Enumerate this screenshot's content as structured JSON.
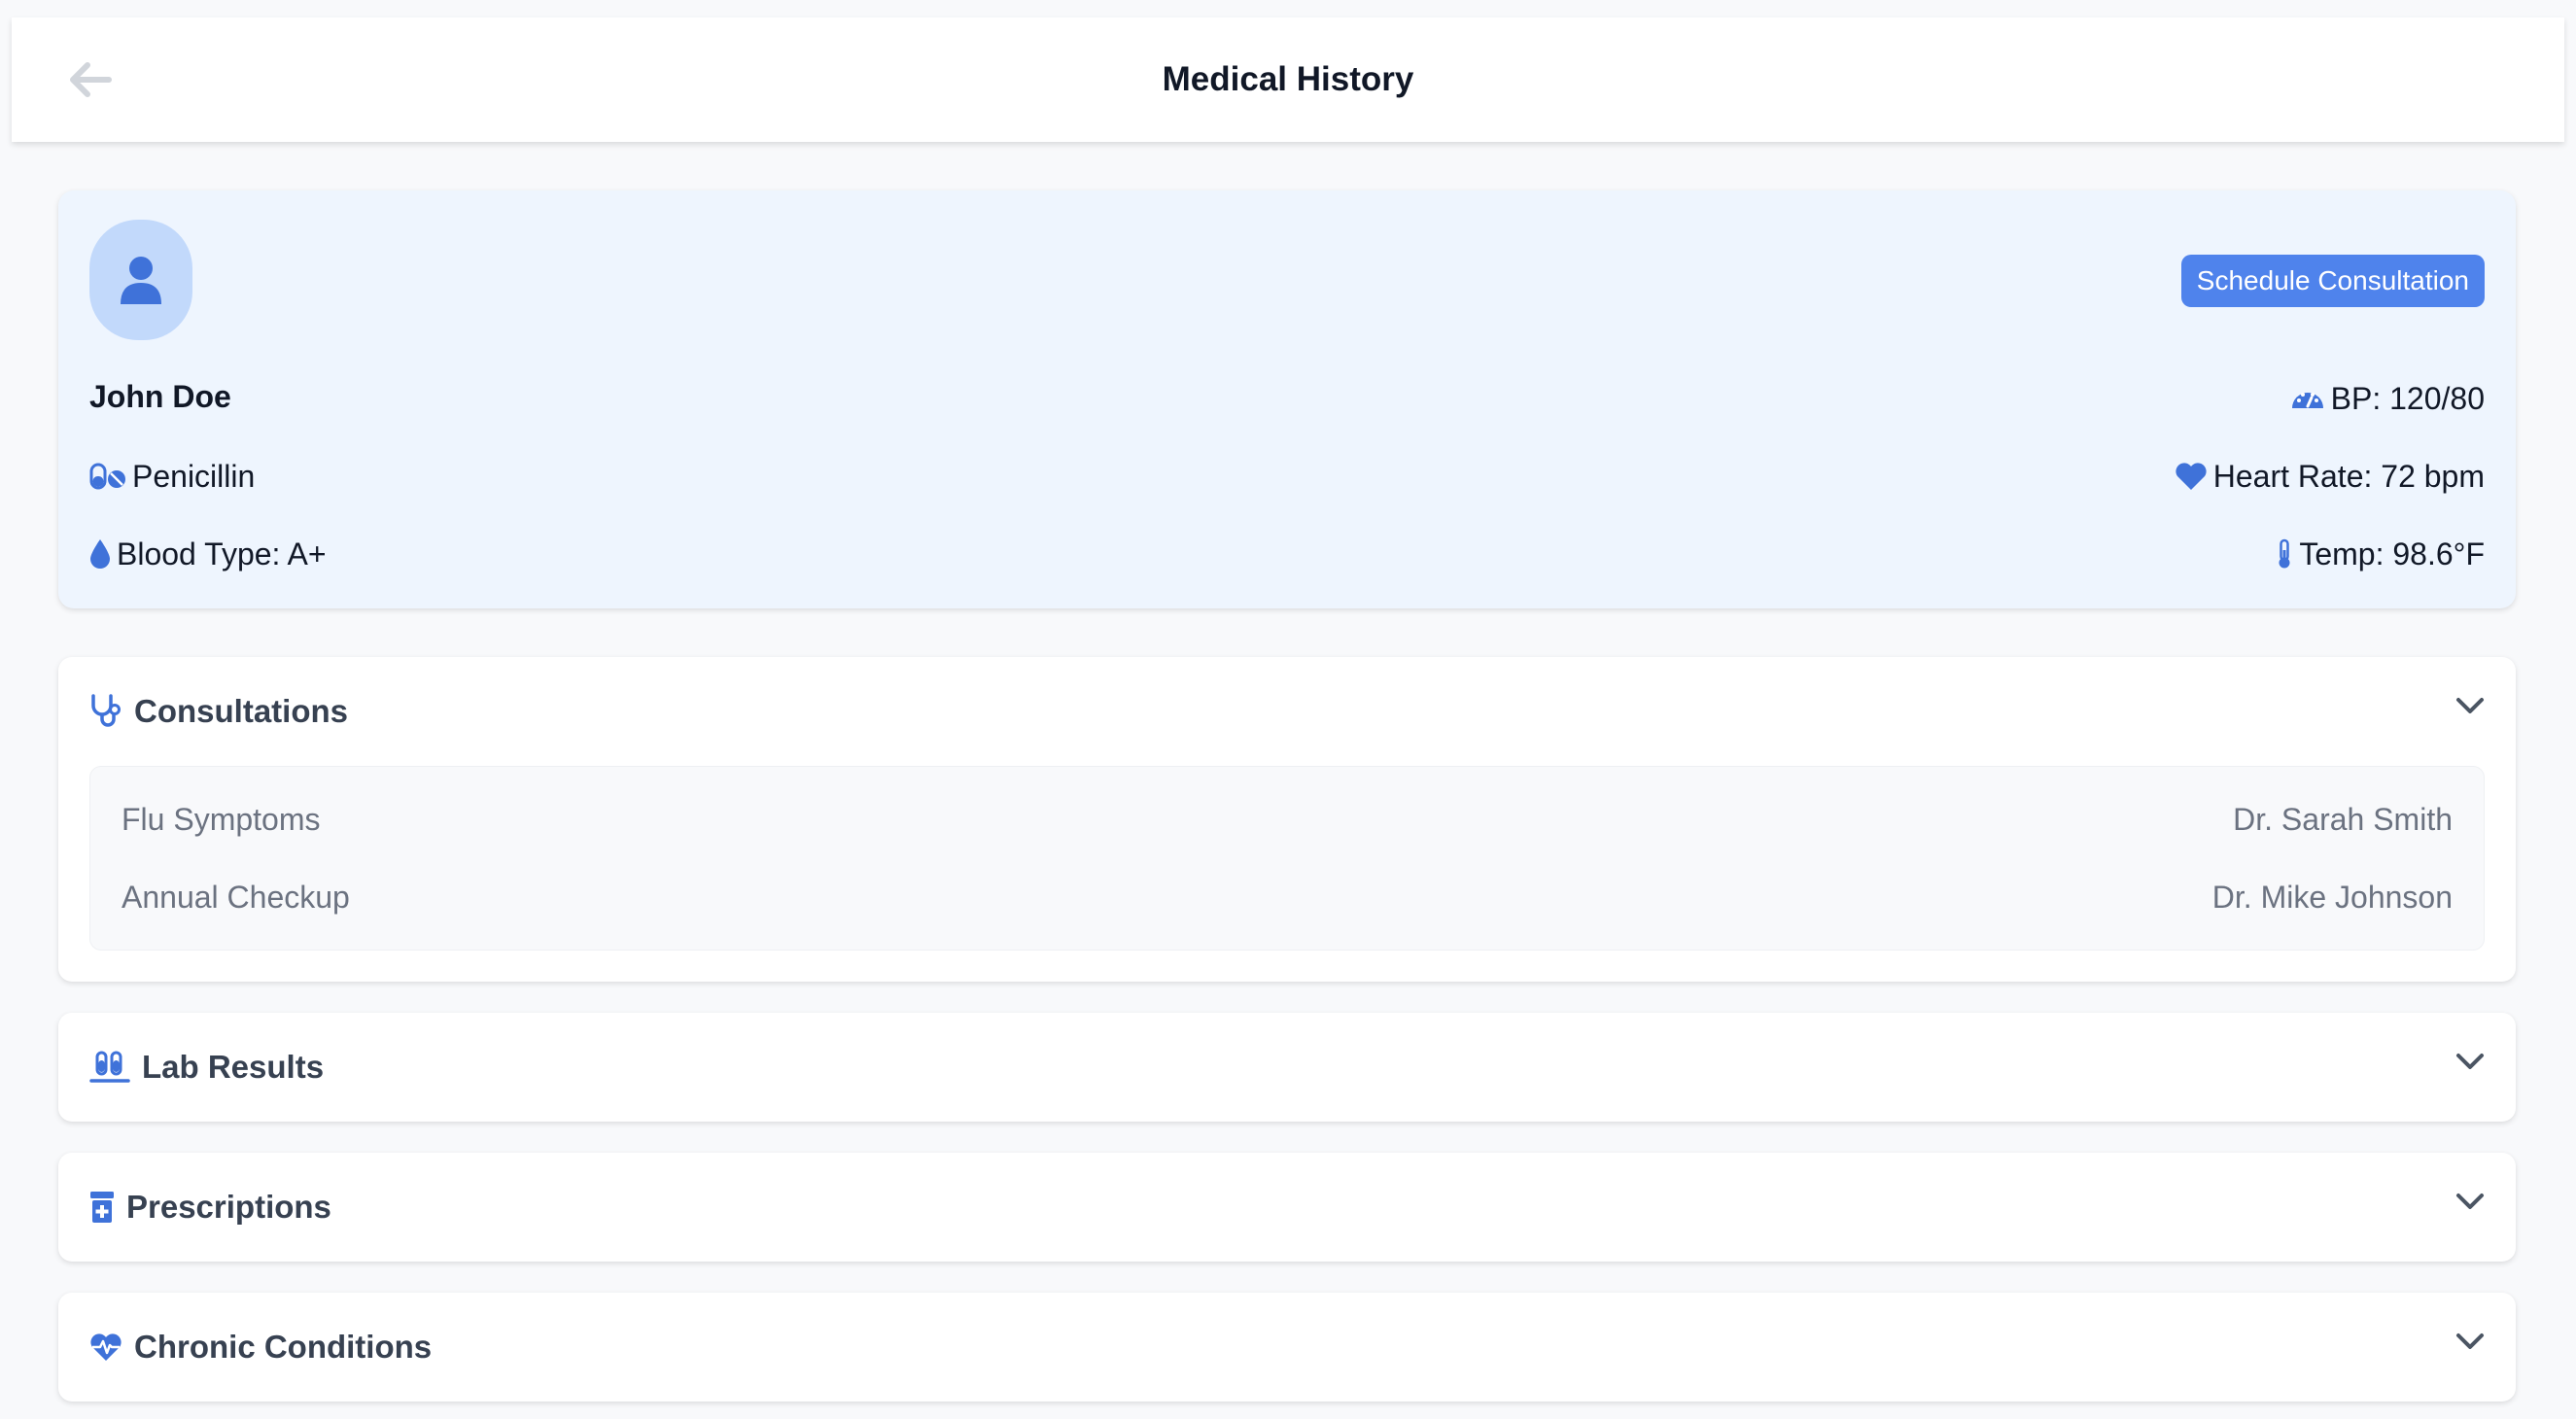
{
  "header": {
    "title": "Medical History"
  },
  "patient": {
    "name": "John Doe",
    "allergy": "Penicillin",
    "blood_type": "Blood Type: A+",
    "bp": "BP: 120/80",
    "heart_rate": "Heart Rate: 72 bpm",
    "temp": "Temp: 98.6°F",
    "schedule_label": "Schedule Consultation"
  },
  "sections": {
    "consultations": {
      "title": "Consultations",
      "items": [
        {
          "reason": "Flu Symptoms",
          "doctor": "Dr. Sarah Smith"
        },
        {
          "reason": "Annual Checkup",
          "doctor": "Dr. Mike Johnson"
        }
      ]
    },
    "lab_results": {
      "title": "Lab Results"
    },
    "prescriptions": {
      "title": "Prescriptions"
    },
    "chronic": {
      "title": "Chronic Conditions"
    }
  },
  "colors": {
    "accent": "#4f83ec",
    "card_bg": "#eef5fe",
    "avatar_bg": "#c2d9fb"
  },
  "icons": [
    "back-arrow-icon",
    "user-icon",
    "pills-icon",
    "droplet-icon",
    "gauge-icon",
    "heart-icon",
    "thermometer-icon",
    "stethoscope-icon",
    "vials-icon",
    "prescription-bottle-icon",
    "heart-pulse-icon",
    "chevron-down-icon"
  ]
}
